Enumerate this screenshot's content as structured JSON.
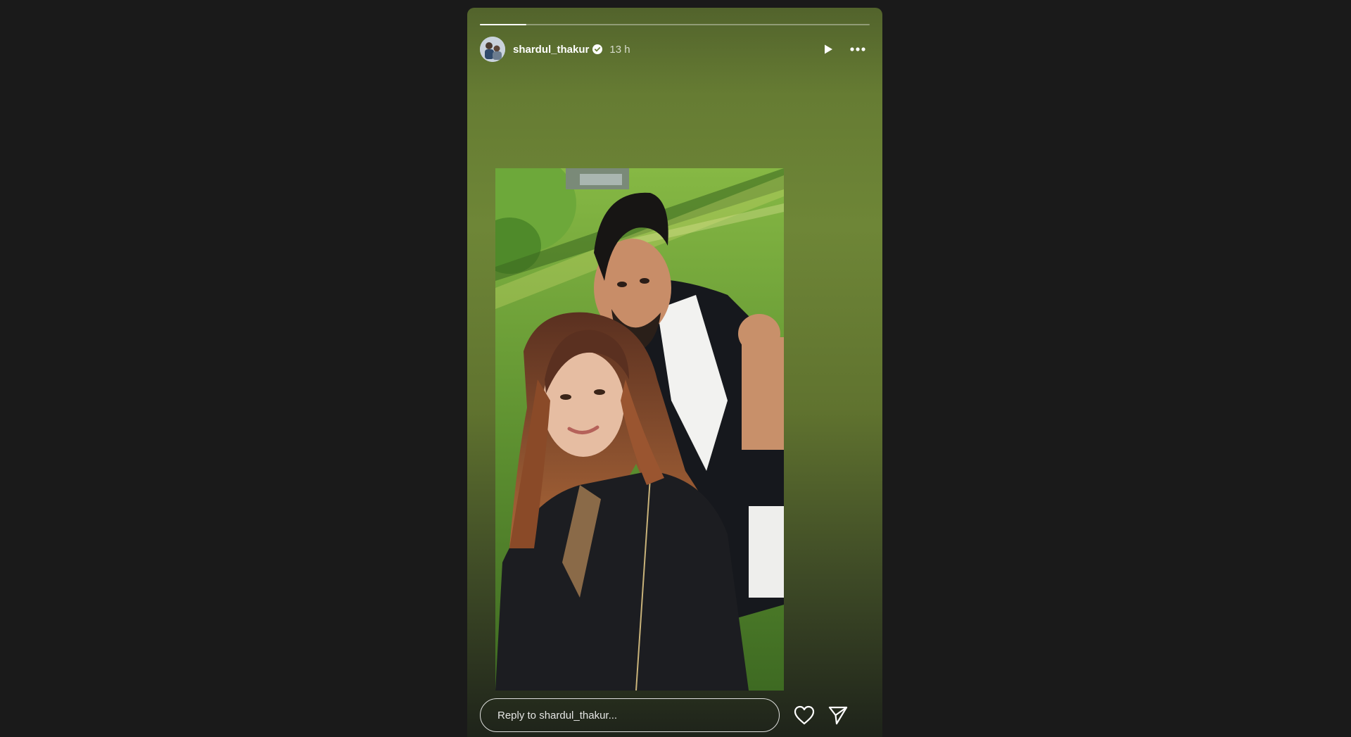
{
  "story": {
    "progress": 0.12,
    "user": {
      "username": "shardul_thakur",
      "verified": true,
      "time_ago": "13 h"
    },
    "controls": {
      "play_icon": "play-icon",
      "more_icon": "more-options-icon"
    },
    "media": {
      "type": "photo"
    },
    "reply": {
      "placeholder": "Reply to shardul_thakur..."
    },
    "actions": {
      "like_icon": "heart-icon",
      "share_icon": "send-icon"
    }
  },
  "colors": {
    "page_background": "#1a1a1a",
    "story_gradient_top": "#667c33",
    "story_gradient_bottom": "#1e231a",
    "text": "#ffffff"
  }
}
